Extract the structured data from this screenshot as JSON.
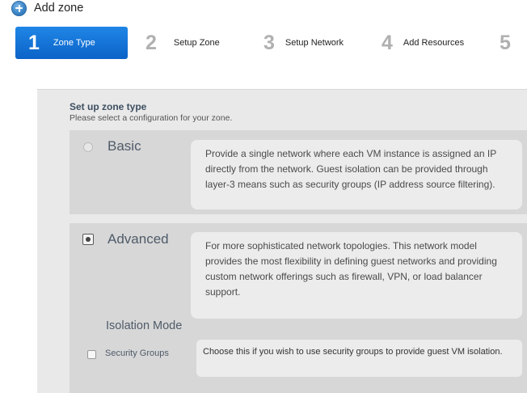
{
  "dialog": {
    "title": "Add zone",
    "icon": "add-circle-icon"
  },
  "steps": [
    {
      "number": "1",
      "label": "Zone Type",
      "active": true
    },
    {
      "number": "2",
      "label": "Setup Zone",
      "active": false
    },
    {
      "number": "3",
      "label": "Setup Network",
      "active": false
    },
    {
      "number": "4",
      "label": "Add Resources",
      "active": false
    },
    {
      "number": "5",
      "label": "",
      "active": false
    }
  ],
  "zone_type": {
    "title": "Set up zone type",
    "subtitle": "Please select a configuration for your zone.",
    "options": {
      "basic": {
        "name": "Basic",
        "selected": false,
        "description": "Provide a single network where each VM instance is assigned an IP directly from the network. Guest isolation can be provided through layer-3 means such as security groups (IP address source filtering)."
      },
      "advanced": {
        "name": "Advanced",
        "selected": true,
        "description": "For more sophisticated network topologies. This network model provides the most flexibility in defining guest networks and providing custom network offerings such as firewall, VPN, or load balancer support."
      }
    },
    "isolation": {
      "title": "Isolation Mode",
      "security_groups_label": "Security Groups",
      "security_groups_checked": false,
      "security_groups_description": "Choose this if you wish to use security groups to provide guest VM isolation."
    }
  },
  "colors": {
    "active_step": "#0c63c8",
    "inactive_step_number": "#b0b0b0",
    "panel_background": "#e9e9e9",
    "option_background": "#d7d7d7"
  }
}
